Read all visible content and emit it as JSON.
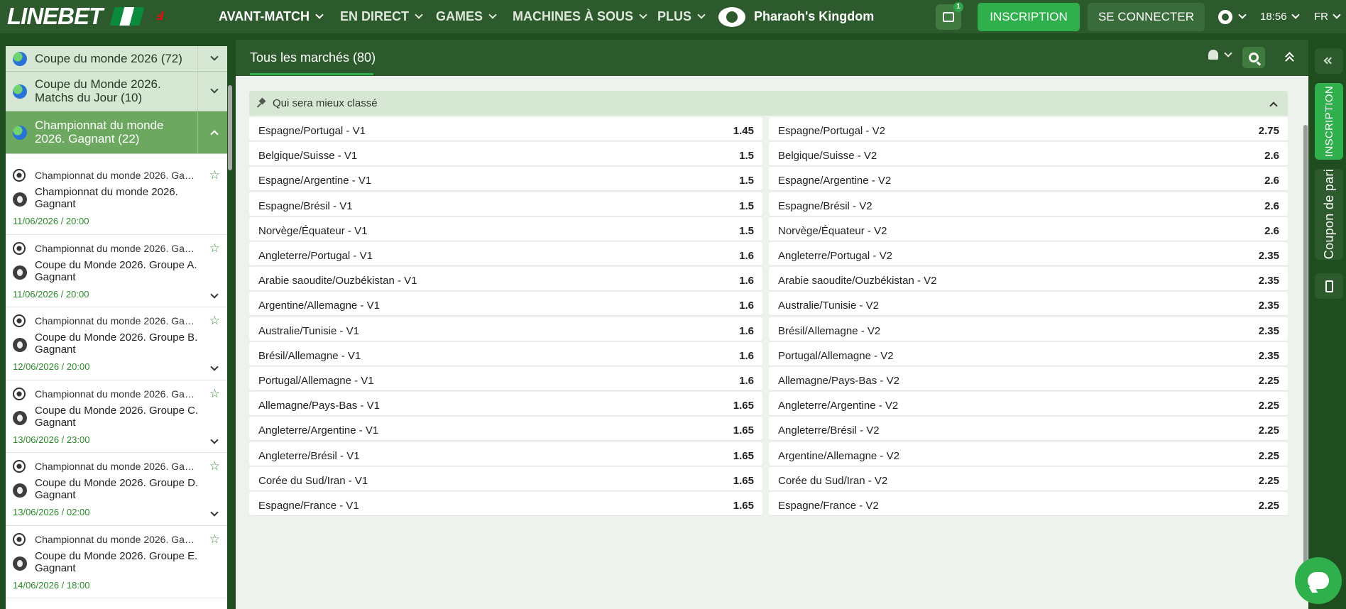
{
  "header": {
    "logo_text": "LINEBET",
    "promo_logo_text": "Ⅎ",
    "nav": [
      {
        "label": "AVANT-MATCH"
      },
      {
        "label": "EN DIRECT"
      },
      {
        "label": "GAMES"
      },
      {
        "label": "MACHINES À SOUS"
      },
      {
        "label": "PLUS"
      }
    ],
    "featured_game": "Pharaoh's Kingdom",
    "gift_badge": "1",
    "register_label": "INSCRIPTION",
    "login_label": "SE CONNECTER",
    "time": "18:56",
    "language": "FR"
  },
  "sidebar": {
    "categories": [
      {
        "label": "Coupe du monde 2026 (72)"
      },
      {
        "label": "Coupe du Monde 2026. Matchs du Jour (10)"
      },
      {
        "label": "Championnat du monde 2026. Gagnant (22)"
      }
    ],
    "events": [
      {
        "league": "Championnat du monde 2026. Gagnant",
        "name": "Championnat du monde 2026. Gagnant",
        "date": "11/06/2026 / 20:00"
      },
      {
        "league": "Championnat du monde 2026. Gagnant",
        "name": "Coupe du Monde 2026. Groupe A. Gagnant",
        "date": "11/06/2026 / 20:00"
      },
      {
        "league": "Championnat du monde 2026. Gagnant",
        "name": "Coupe du Monde 2026. Groupe B. Gagnant",
        "date": "12/06/2026 / 20:00"
      },
      {
        "league": "Championnat du monde 2026. Gagnant",
        "name": "Coupe du Monde 2026. Groupe C. Gagnant",
        "date": "13/06/2026 / 23:00"
      },
      {
        "league": "Championnat du monde 2026. Gagnant",
        "name": "Coupe du Monde 2026. Groupe D. Gagnant",
        "date": "13/06/2026 / 02:00"
      },
      {
        "league": "Championnat du monde 2026. Gagnant",
        "name": "Coupe du Monde 2026. Groupe E. Gagnant",
        "date": "14/06/2026 / 18:00"
      }
    ]
  },
  "main": {
    "tab_label": "Tous les marchés (80)",
    "market_title": "Qui sera mieux classé",
    "left_odds": [
      {
        "name": "Espagne/Portugal - V1",
        "value": "1.45"
      },
      {
        "name": "Belgique/Suisse - V1",
        "value": "1.5"
      },
      {
        "name": "Espagne/Argentine - V1",
        "value": "1.5"
      },
      {
        "name": "Espagne/Brésil - V1",
        "value": "1.5"
      },
      {
        "name": "Norvège/Équateur - V1",
        "value": "1.5"
      },
      {
        "name": "Angleterre/Portugal - V1",
        "value": "1.6"
      },
      {
        "name": "Arabie saoudite/Ouzbékistan - V1",
        "value": "1.6"
      },
      {
        "name": "Argentine/Allemagne - V1",
        "value": "1.6"
      },
      {
        "name": "Australie/Tunisie - V1",
        "value": "1.6"
      },
      {
        "name": "Brésil/Allemagne - V1",
        "value": "1.6"
      },
      {
        "name": "Portugal/Allemagne - V1",
        "value": "1.6"
      },
      {
        "name": "Allemagne/Pays-Bas - V1",
        "value": "1.65"
      },
      {
        "name": "Angleterre/Argentine - V1",
        "value": "1.65"
      },
      {
        "name": "Angleterre/Brésil - V1",
        "value": "1.65"
      },
      {
        "name": "Corée du Sud/Iran - V1",
        "value": "1.65"
      },
      {
        "name": "Espagne/France - V1",
        "value": "1.65"
      }
    ],
    "right_odds": [
      {
        "name": "Espagne/Portugal - V2",
        "value": "2.75"
      },
      {
        "name": "Belgique/Suisse - V2",
        "value": "2.6"
      },
      {
        "name": "Espagne/Argentine - V2",
        "value": "2.6"
      },
      {
        "name": "Espagne/Brésil - V2",
        "value": "2.6"
      },
      {
        "name": "Norvège/Équateur - V2",
        "value": "2.6"
      },
      {
        "name": "Angleterre/Portugal - V2",
        "value": "2.35"
      },
      {
        "name": "Arabie saoudite/Ouzbékistan - V2",
        "value": "2.35"
      },
      {
        "name": "Australie/Tunisie - V2",
        "value": "2.35"
      },
      {
        "name": "Brésil/Allemagne - V2",
        "value": "2.35"
      },
      {
        "name": "Portugal/Allemagne - V2",
        "value": "2.35"
      },
      {
        "name": "Allemagne/Pays-Bas - V2",
        "value": "2.25"
      },
      {
        "name": "Angleterre/Argentine - V2",
        "value": "2.25"
      },
      {
        "name": "Angleterre/Brésil - V2",
        "value": "2.25"
      },
      {
        "name": "Argentine/Allemagne - V2",
        "value": "2.25"
      },
      {
        "name": "Corée du Sud/Iran - V2",
        "value": "2.25"
      },
      {
        "name": "Espagne/France - V2",
        "value": "2.25"
      }
    ]
  },
  "rail": {
    "inscription_label": "INSCRIPTION",
    "coupon_label": "Coupon de pari"
  },
  "colors": {
    "brand_green": "#2c5a2c",
    "accent_green": "#2fb04c",
    "light_green": "#d6e8d3"
  }
}
